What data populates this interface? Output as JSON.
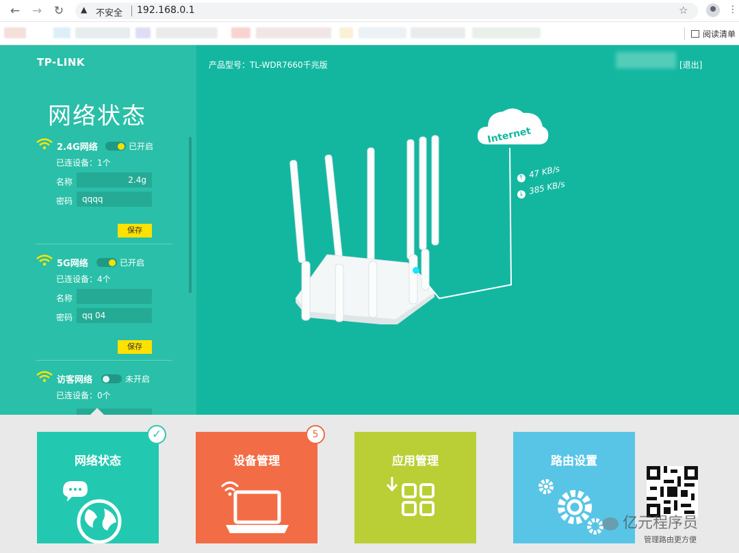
{
  "browser": {
    "security_label": "不安全",
    "url": "192.168.0.1",
    "reading_list_label": "阅读清单"
  },
  "router": {
    "brand": "TP-LINK",
    "page_title": "网络状态",
    "model_label": "产品型号：TL-WDR7660千兆版",
    "logout_label": "[退出]",
    "internet_label": "Internet",
    "upload_speed": "47 KB/s",
    "download_speed": "385 KB/s"
  },
  "networks": [
    {
      "name": "2.4G网络",
      "enabled": true,
      "state": "已开启",
      "devices": "已连设备：1个",
      "ssid_label": "名称",
      "ssid_value": "2.4g",
      "password_label": "密码",
      "password_value": "qqqq",
      "save_label": "保存"
    },
    {
      "name": "5G网络",
      "enabled": true,
      "state": "已开启",
      "devices": "已连设备：4个",
      "ssid_label": "名称",
      "ssid_value": "",
      "password_label": "密码",
      "password_value": "qq   04",
      "save_label": "保存"
    },
    {
      "name": "访客网络",
      "enabled": false,
      "state": "未开启",
      "devices": "已连设备：0个"
    }
  ],
  "tiles": [
    {
      "label": "网络状态",
      "color": "#22c9b0",
      "icon": "globe-chat-icon",
      "badge": "check"
    },
    {
      "label": "设备管理",
      "color": "#f26d45",
      "icon": "laptop-wifi-icon",
      "badge": "5"
    },
    {
      "label": "应用管理",
      "color": "#b9cf35",
      "icon": "apps-grid-icon"
    },
    {
      "label": "路由设置",
      "color": "#58c5e6",
      "icon": "gears-icon"
    }
  ],
  "footer": {
    "watermark": "亿元程序员",
    "qr_caption": "管理路由更方便"
  }
}
